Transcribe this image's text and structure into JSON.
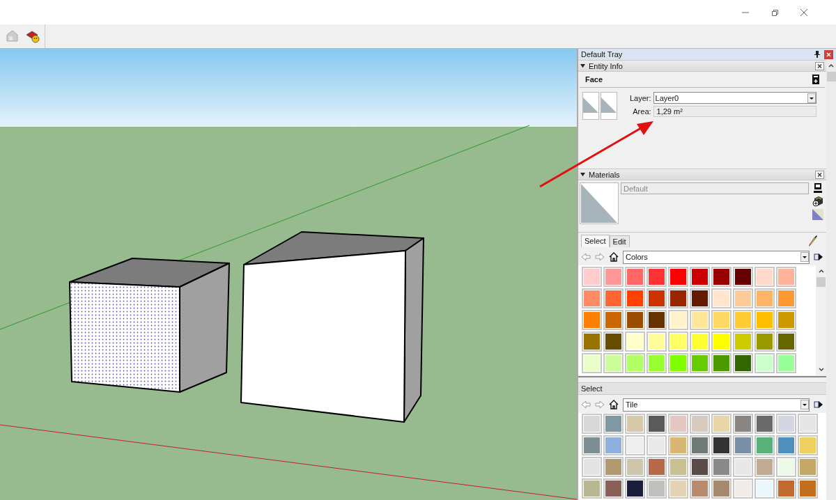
{
  "tray": {
    "title": "Default Tray",
    "entity_info": {
      "title": "Entity Info",
      "expanded": true,
      "entity_type": "Face",
      "layer_label": "Layer:",
      "layer": "Layer0",
      "area_label": "Area:",
      "area": "1,29 m²"
    },
    "materials": {
      "title": "Materials",
      "expanded": true,
      "material_name": "Default",
      "tabs": [
        {
          "label": "Select",
          "selected": true
        },
        {
          "label": "Edit",
          "selected": false
        }
      ],
      "library": "Colors",
      "swatches": [
        {
          "color": "#ffcccc"
        },
        {
          "color": "#ff9999"
        },
        {
          "color": "#ff6666"
        },
        {
          "color": "#ff3333"
        },
        {
          "color": "#ff0000"
        },
        {
          "color": "#cc0000"
        },
        {
          "color": "#990000"
        },
        {
          "color": "#660000"
        },
        {
          "color": "#ffd9cc"
        },
        {
          "color": "#ffb399"
        },
        {
          "color": "#ff8c66"
        },
        {
          "color": "#ff6633"
        },
        {
          "color": "#ff4000"
        },
        {
          "color": "#cc3300"
        },
        {
          "color": "#992600"
        },
        {
          "color": "#661a00"
        },
        {
          "color": "#ffe6cc"
        },
        {
          "color": "#ffcc99"
        },
        {
          "color": "#ffb366"
        },
        {
          "color": "#ff9933"
        },
        {
          "color": "#ff8000"
        },
        {
          "color": "#cc6600"
        },
        {
          "color": "#994d00"
        },
        {
          "color": "#663300"
        },
        {
          "color": "#fff2cc"
        },
        {
          "color": "#ffe699"
        },
        {
          "color": "#ffd966"
        },
        {
          "color": "#ffcc33"
        },
        {
          "color": "#ffbf00"
        },
        {
          "color": "#cc9900"
        },
        {
          "color": "#997300"
        },
        {
          "color": "#664d00"
        },
        {
          "color": "#ffffcc"
        },
        {
          "color": "#ffff99"
        },
        {
          "color": "#ffff66"
        },
        {
          "color": "#ffff33"
        },
        {
          "color": "#ffff00"
        },
        {
          "color": "#cccc00"
        },
        {
          "color": "#999900"
        },
        {
          "color": "#666600"
        },
        {
          "color": "#eaffcc"
        },
        {
          "color": "#ccff99"
        },
        {
          "color": "#b3ff66"
        },
        {
          "color": "#99ff33"
        },
        {
          "color": "#80ff00"
        },
        {
          "color": "#66cc00"
        },
        {
          "color": "#4d9900"
        },
        {
          "color": "#336600"
        },
        {
          "color": "#ccffcc"
        },
        {
          "color": "#99ff99"
        }
      ]
    },
    "secondary_browser": {
      "title": "Select",
      "library": "Tile",
      "tiles": [
        {
          "color": "#d6d9d6"
        },
        {
          "color": "#7f98a3"
        },
        {
          "color": "#d7c9a8"
        },
        {
          "color": "#5a5a5a"
        },
        {
          "color": "#e3c7c0"
        },
        {
          "color": "#d8cbbd"
        },
        {
          "color": "#e8d6a8"
        },
        {
          "color": "#8a8580"
        },
        {
          "color": "#6a6a6a"
        },
        {
          "color": "#d4d6e4"
        },
        {
          "color": "#e6e6e6"
        },
        {
          "color": "#7d8f94"
        },
        {
          "color": "#8fb0dc"
        },
        {
          "color": "#eeeeee"
        },
        {
          "color": "#e9e9e9"
        },
        {
          "color": "#d9b772"
        },
        {
          "color": "#6d7a78"
        },
        {
          "color": "#333333"
        },
        {
          "color": "#7a8fa6"
        },
        {
          "color": "#5ab07a"
        },
        {
          "color": "#4f8fc0"
        },
        {
          "color": "#eed060"
        },
        {
          "color": "#e4e4e2"
        },
        {
          "color": "#b09a6e"
        },
        {
          "color": "#cfc7ad"
        },
        {
          "color": "#b86a48"
        },
        {
          "color": "#c8c090"
        },
        {
          "color": "#5a4a48"
        },
        {
          "color": "#8a8a8a"
        },
        {
          "color": "#e8e8e8"
        },
        {
          "color": "#c2ab95"
        },
        {
          "color": "#eefae8"
        },
        {
          "color": "#c6a866"
        },
        {
          "color": "#b8b890"
        },
        {
          "color": "#8a6058"
        },
        {
          "color": "#1a1e3a"
        },
        {
          "color": "#c2c0bc"
        },
        {
          "color": "#e4d4b4"
        },
        {
          "color": "#b88a6e"
        },
        {
          "color": "#a58a70"
        },
        {
          "color": "#f2ece8"
        },
        {
          "color": "#eaf8fc"
        },
        {
          "color": "#c26a30"
        },
        {
          "color": "#c46e20"
        }
      ]
    }
  }
}
